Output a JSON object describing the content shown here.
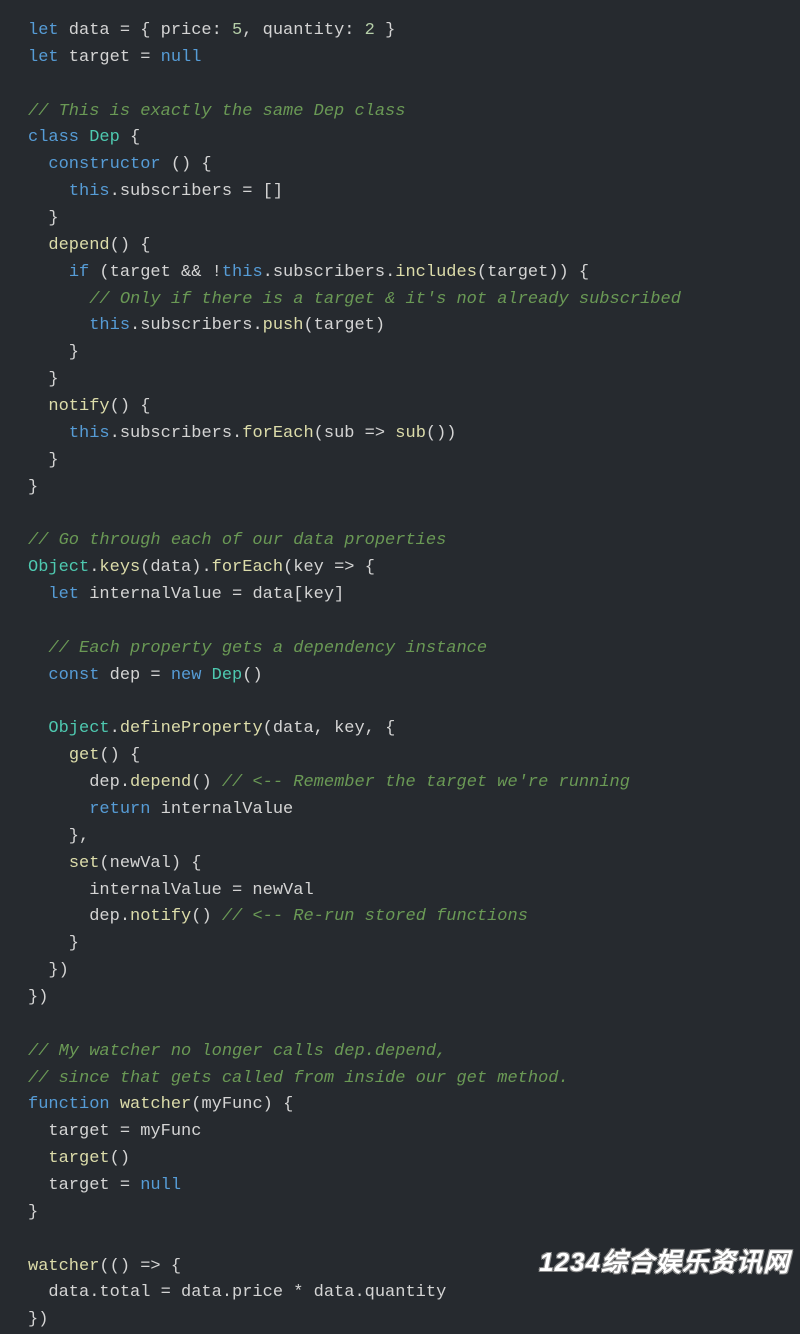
{
  "code": {
    "lines": [
      {
        "t": "code",
        "tokens": [
          {
            "c": "kw",
            "s": "let"
          },
          {
            "c": "punc",
            "s": " data = { price: "
          },
          {
            "c": "num",
            "s": "5"
          },
          {
            "c": "punc",
            "s": ", quantity: "
          },
          {
            "c": "num",
            "s": "2"
          },
          {
            "c": "punc",
            "s": " }"
          }
        ]
      },
      {
        "t": "code",
        "tokens": [
          {
            "c": "kw",
            "s": "let"
          },
          {
            "c": "punc",
            "s": " target = "
          },
          {
            "c": "null",
            "s": "null"
          }
        ]
      },
      {
        "t": "blank"
      },
      {
        "t": "code",
        "tokens": [
          {
            "c": "com",
            "s": "// This is exactly the same Dep class"
          }
        ]
      },
      {
        "t": "code",
        "tokens": [
          {
            "c": "kw",
            "s": "class"
          },
          {
            "c": "punc",
            "s": " "
          },
          {
            "c": "cls",
            "s": "Dep"
          },
          {
            "c": "punc",
            "s": " {"
          }
        ]
      },
      {
        "t": "code",
        "tokens": [
          {
            "c": "punc",
            "s": "  "
          },
          {
            "c": "kw",
            "s": "constructor"
          },
          {
            "c": "punc",
            "s": " () {"
          }
        ]
      },
      {
        "t": "code",
        "tokens": [
          {
            "c": "punc",
            "s": "    "
          },
          {
            "c": "this",
            "s": "this"
          },
          {
            "c": "punc",
            "s": ".subscribers = []"
          }
        ]
      },
      {
        "t": "code",
        "tokens": [
          {
            "c": "punc",
            "s": "  }"
          }
        ]
      },
      {
        "t": "code",
        "tokens": [
          {
            "c": "punc",
            "s": "  "
          },
          {
            "c": "fn",
            "s": "depend"
          },
          {
            "c": "punc",
            "s": "() {"
          }
        ]
      },
      {
        "t": "code",
        "tokens": [
          {
            "c": "punc",
            "s": "    "
          },
          {
            "c": "kw",
            "s": "if"
          },
          {
            "c": "punc",
            "s": " (target && !"
          },
          {
            "c": "this",
            "s": "this"
          },
          {
            "c": "punc",
            "s": ".subscribers."
          },
          {
            "c": "fn",
            "s": "includes"
          },
          {
            "c": "punc",
            "s": "(target)) {"
          }
        ]
      },
      {
        "t": "code",
        "tokens": [
          {
            "c": "punc",
            "s": "      "
          },
          {
            "c": "com",
            "s": "// Only if there is a target & it's not already subscribed"
          }
        ]
      },
      {
        "t": "code",
        "tokens": [
          {
            "c": "punc",
            "s": "      "
          },
          {
            "c": "this",
            "s": "this"
          },
          {
            "c": "punc",
            "s": ".subscribers."
          },
          {
            "c": "fn",
            "s": "push"
          },
          {
            "c": "punc",
            "s": "(target)"
          }
        ]
      },
      {
        "t": "code",
        "tokens": [
          {
            "c": "punc",
            "s": "    }"
          }
        ]
      },
      {
        "t": "code",
        "tokens": [
          {
            "c": "punc",
            "s": "  }"
          }
        ]
      },
      {
        "t": "code",
        "tokens": [
          {
            "c": "punc",
            "s": "  "
          },
          {
            "c": "fn",
            "s": "notify"
          },
          {
            "c": "punc",
            "s": "() {"
          }
        ]
      },
      {
        "t": "code",
        "tokens": [
          {
            "c": "punc",
            "s": "    "
          },
          {
            "c": "this",
            "s": "this"
          },
          {
            "c": "punc",
            "s": ".subscribers."
          },
          {
            "c": "fn",
            "s": "forEach"
          },
          {
            "c": "punc",
            "s": "(sub => "
          },
          {
            "c": "fn",
            "s": "sub"
          },
          {
            "c": "punc",
            "s": "())"
          }
        ]
      },
      {
        "t": "code",
        "tokens": [
          {
            "c": "punc",
            "s": "  }"
          }
        ]
      },
      {
        "t": "code",
        "tokens": [
          {
            "c": "punc",
            "s": "}"
          }
        ]
      },
      {
        "t": "blank"
      },
      {
        "t": "code",
        "tokens": [
          {
            "c": "com",
            "s": "// Go through each of our data properties"
          }
        ]
      },
      {
        "t": "code",
        "tokens": [
          {
            "c": "obj",
            "s": "Object"
          },
          {
            "c": "punc",
            "s": "."
          },
          {
            "c": "fn",
            "s": "keys"
          },
          {
            "c": "punc",
            "s": "(data)."
          },
          {
            "c": "fn",
            "s": "forEach"
          },
          {
            "c": "punc",
            "s": "(key => {"
          }
        ]
      },
      {
        "t": "code",
        "tokens": [
          {
            "c": "punc",
            "s": "  "
          },
          {
            "c": "kw",
            "s": "let"
          },
          {
            "c": "punc",
            "s": " internalValue = data[key]"
          }
        ]
      },
      {
        "t": "blank"
      },
      {
        "t": "code",
        "tokens": [
          {
            "c": "punc",
            "s": "  "
          },
          {
            "c": "com",
            "s": "// Each property gets a dependency instance"
          }
        ]
      },
      {
        "t": "code",
        "tokens": [
          {
            "c": "punc",
            "s": "  "
          },
          {
            "c": "kw",
            "s": "const"
          },
          {
            "c": "punc",
            "s": " dep = "
          },
          {
            "c": "kw",
            "s": "new"
          },
          {
            "c": "punc",
            "s": " "
          },
          {
            "c": "cls",
            "s": "Dep"
          },
          {
            "c": "punc",
            "s": "()"
          }
        ]
      },
      {
        "t": "blank"
      },
      {
        "t": "code",
        "tokens": [
          {
            "c": "punc",
            "s": "  "
          },
          {
            "c": "obj",
            "s": "Object"
          },
          {
            "c": "punc",
            "s": "."
          },
          {
            "c": "fn",
            "s": "defineProperty"
          },
          {
            "c": "punc",
            "s": "(data, key, {"
          }
        ]
      },
      {
        "t": "code",
        "tokens": [
          {
            "c": "punc",
            "s": "    "
          },
          {
            "c": "fn",
            "s": "get"
          },
          {
            "c": "punc",
            "s": "() {"
          }
        ]
      },
      {
        "t": "code",
        "tokens": [
          {
            "c": "punc",
            "s": "      dep."
          },
          {
            "c": "fn",
            "s": "depend"
          },
          {
            "c": "punc",
            "s": "() "
          },
          {
            "c": "com",
            "s": "// <-- Remember the target we're running"
          }
        ]
      },
      {
        "t": "code",
        "tokens": [
          {
            "c": "punc",
            "s": "      "
          },
          {
            "c": "kw",
            "s": "return"
          },
          {
            "c": "punc",
            "s": " internalValue"
          }
        ]
      },
      {
        "t": "code",
        "tokens": [
          {
            "c": "punc",
            "s": "    },"
          }
        ]
      },
      {
        "t": "code",
        "tokens": [
          {
            "c": "punc",
            "s": "    "
          },
          {
            "c": "fn",
            "s": "set"
          },
          {
            "c": "punc",
            "s": "(newVal) {"
          }
        ]
      },
      {
        "t": "code",
        "tokens": [
          {
            "c": "punc",
            "s": "      internalValue = newVal"
          }
        ]
      },
      {
        "t": "code",
        "tokens": [
          {
            "c": "punc",
            "s": "      dep."
          },
          {
            "c": "fn",
            "s": "notify"
          },
          {
            "c": "punc",
            "s": "() "
          },
          {
            "c": "com",
            "s": "// <-- Re-run stored functions"
          }
        ]
      },
      {
        "t": "code",
        "tokens": [
          {
            "c": "punc",
            "s": "    }"
          }
        ]
      },
      {
        "t": "code",
        "tokens": [
          {
            "c": "punc",
            "s": "  })"
          }
        ]
      },
      {
        "t": "code",
        "tokens": [
          {
            "c": "punc",
            "s": "})"
          }
        ]
      },
      {
        "t": "blank"
      },
      {
        "t": "code",
        "tokens": [
          {
            "c": "com",
            "s": "// My watcher no longer calls dep.depend,"
          }
        ]
      },
      {
        "t": "code",
        "tokens": [
          {
            "c": "com",
            "s": "// since that gets called from inside our get method."
          }
        ]
      },
      {
        "t": "code",
        "tokens": [
          {
            "c": "kw",
            "s": "function"
          },
          {
            "c": "punc",
            "s": " "
          },
          {
            "c": "fn",
            "s": "watcher"
          },
          {
            "c": "punc",
            "s": "(myFunc) {"
          }
        ]
      },
      {
        "t": "code",
        "tokens": [
          {
            "c": "punc",
            "s": "  target = myFunc"
          }
        ]
      },
      {
        "t": "code",
        "tokens": [
          {
            "c": "punc",
            "s": "  "
          },
          {
            "c": "fn",
            "s": "target"
          },
          {
            "c": "punc",
            "s": "()"
          }
        ]
      },
      {
        "t": "code",
        "tokens": [
          {
            "c": "punc",
            "s": "  target = "
          },
          {
            "c": "null",
            "s": "null"
          }
        ]
      },
      {
        "t": "code",
        "tokens": [
          {
            "c": "punc",
            "s": "}"
          }
        ]
      },
      {
        "t": "blank"
      },
      {
        "t": "code",
        "tokens": [
          {
            "c": "fn",
            "s": "watcher"
          },
          {
            "c": "punc",
            "s": "(() => {"
          }
        ]
      },
      {
        "t": "code",
        "tokens": [
          {
            "c": "punc",
            "s": "  data.total = data.price * data.quantity"
          }
        ]
      },
      {
        "t": "code",
        "tokens": [
          {
            "c": "punc",
            "s": "})"
          }
        ]
      }
    ]
  },
  "watermark": "1234综合娱乐资讯网"
}
